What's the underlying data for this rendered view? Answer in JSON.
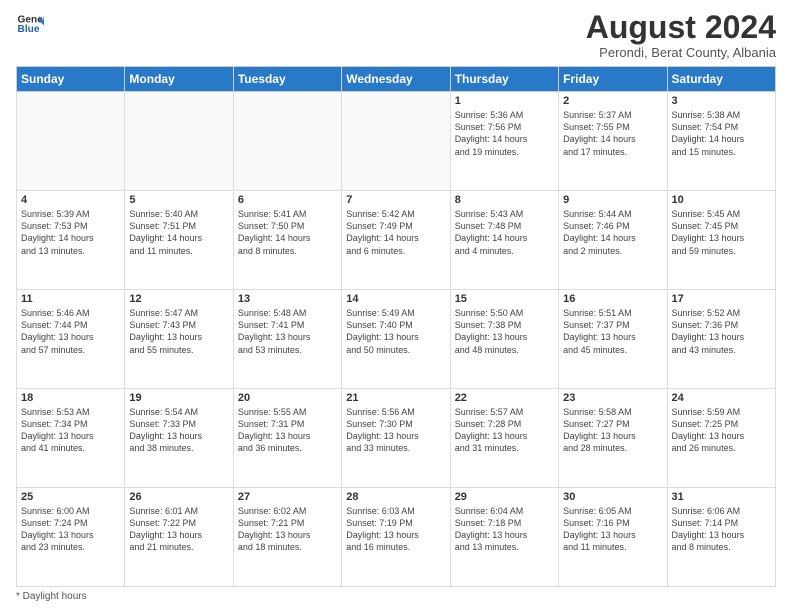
{
  "logo": {
    "line1": "General",
    "line2": "Blue"
  },
  "header": {
    "title": "August 2024",
    "subtitle": "Perondi, Berat County, Albania"
  },
  "days_of_week": [
    "Sunday",
    "Monday",
    "Tuesday",
    "Wednesday",
    "Thursday",
    "Friday",
    "Saturday"
  ],
  "weeks": [
    [
      {
        "day": "",
        "info": ""
      },
      {
        "day": "",
        "info": ""
      },
      {
        "day": "",
        "info": ""
      },
      {
        "day": "",
        "info": ""
      },
      {
        "day": "1",
        "info": "Sunrise: 5:36 AM\nSunset: 7:56 PM\nDaylight: 14 hours\nand 19 minutes."
      },
      {
        "day": "2",
        "info": "Sunrise: 5:37 AM\nSunset: 7:55 PM\nDaylight: 14 hours\nand 17 minutes."
      },
      {
        "day": "3",
        "info": "Sunrise: 5:38 AM\nSunset: 7:54 PM\nDaylight: 14 hours\nand 15 minutes."
      }
    ],
    [
      {
        "day": "4",
        "info": "Sunrise: 5:39 AM\nSunset: 7:53 PM\nDaylight: 14 hours\nand 13 minutes."
      },
      {
        "day": "5",
        "info": "Sunrise: 5:40 AM\nSunset: 7:51 PM\nDaylight: 14 hours\nand 11 minutes."
      },
      {
        "day": "6",
        "info": "Sunrise: 5:41 AM\nSunset: 7:50 PM\nDaylight: 14 hours\nand 8 minutes."
      },
      {
        "day": "7",
        "info": "Sunrise: 5:42 AM\nSunset: 7:49 PM\nDaylight: 14 hours\nand 6 minutes."
      },
      {
        "day": "8",
        "info": "Sunrise: 5:43 AM\nSunset: 7:48 PM\nDaylight: 14 hours\nand 4 minutes."
      },
      {
        "day": "9",
        "info": "Sunrise: 5:44 AM\nSunset: 7:46 PM\nDaylight: 14 hours\nand 2 minutes."
      },
      {
        "day": "10",
        "info": "Sunrise: 5:45 AM\nSunset: 7:45 PM\nDaylight: 13 hours\nand 59 minutes."
      }
    ],
    [
      {
        "day": "11",
        "info": "Sunrise: 5:46 AM\nSunset: 7:44 PM\nDaylight: 13 hours\nand 57 minutes."
      },
      {
        "day": "12",
        "info": "Sunrise: 5:47 AM\nSunset: 7:43 PM\nDaylight: 13 hours\nand 55 minutes."
      },
      {
        "day": "13",
        "info": "Sunrise: 5:48 AM\nSunset: 7:41 PM\nDaylight: 13 hours\nand 53 minutes."
      },
      {
        "day": "14",
        "info": "Sunrise: 5:49 AM\nSunset: 7:40 PM\nDaylight: 13 hours\nand 50 minutes."
      },
      {
        "day": "15",
        "info": "Sunrise: 5:50 AM\nSunset: 7:38 PM\nDaylight: 13 hours\nand 48 minutes."
      },
      {
        "day": "16",
        "info": "Sunrise: 5:51 AM\nSunset: 7:37 PM\nDaylight: 13 hours\nand 45 minutes."
      },
      {
        "day": "17",
        "info": "Sunrise: 5:52 AM\nSunset: 7:36 PM\nDaylight: 13 hours\nand 43 minutes."
      }
    ],
    [
      {
        "day": "18",
        "info": "Sunrise: 5:53 AM\nSunset: 7:34 PM\nDaylight: 13 hours\nand 41 minutes."
      },
      {
        "day": "19",
        "info": "Sunrise: 5:54 AM\nSunset: 7:33 PM\nDaylight: 13 hours\nand 38 minutes."
      },
      {
        "day": "20",
        "info": "Sunrise: 5:55 AM\nSunset: 7:31 PM\nDaylight: 13 hours\nand 36 minutes."
      },
      {
        "day": "21",
        "info": "Sunrise: 5:56 AM\nSunset: 7:30 PM\nDaylight: 13 hours\nand 33 minutes."
      },
      {
        "day": "22",
        "info": "Sunrise: 5:57 AM\nSunset: 7:28 PM\nDaylight: 13 hours\nand 31 minutes."
      },
      {
        "day": "23",
        "info": "Sunrise: 5:58 AM\nSunset: 7:27 PM\nDaylight: 13 hours\nand 28 minutes."
      },
      {
        "day": "24",
        "info": "Sunrise: 5:59 AM\nSunset: 7:25 PM\nDaylight: 13 hours\nand 26 minutes."
      }
    ],
    [
      {
        "day": "25",
        "info": "Sunrise: 6:00 AM\nSunset: 7:24 PM\nDaylight: 13 hours\nand 23 minutes."
      },
      {
        "day": "26",
        "info": "Sunrise: 6:01 AM\nSunset: 7:22 PM\nDaylight: 13 hours\nand 21 minutes."
      },
      {
        "day": "27",
        "info": "Sunrise: 6:02 AM\nSunset: 7:21 PM\nDaylight: 13 hours\nand 18 minutes."
      },
      {
        "day": "28",
        "info": "Sunrise: 6:03 AM\nSunset: 7:19 PM\nDaylight: 13 hours\nand 16 minutes."
      },
      {
        "day": "29",
        "info": "Sunrise: 6:04 AM\nSunset: 7:18 PM\nDaylight: 13 hours\nand 13 minutes."
      },
      {
        "day": "30",
        "info": "Sunrise: 6:05 AM\nSunset: 7:16 PM\nDaylight: 13 hours\nand 11 minutes."
      },
      {
        "day": "31",
        "info": "Sunrise: 6:06 AM\nSunset: 7:14 PM\nDaylight: 13 hours\nand 8 minutes."
      }
    ]
  ],
  "footer": {
    "daylight_label": "Daylight hours"
  }
}
